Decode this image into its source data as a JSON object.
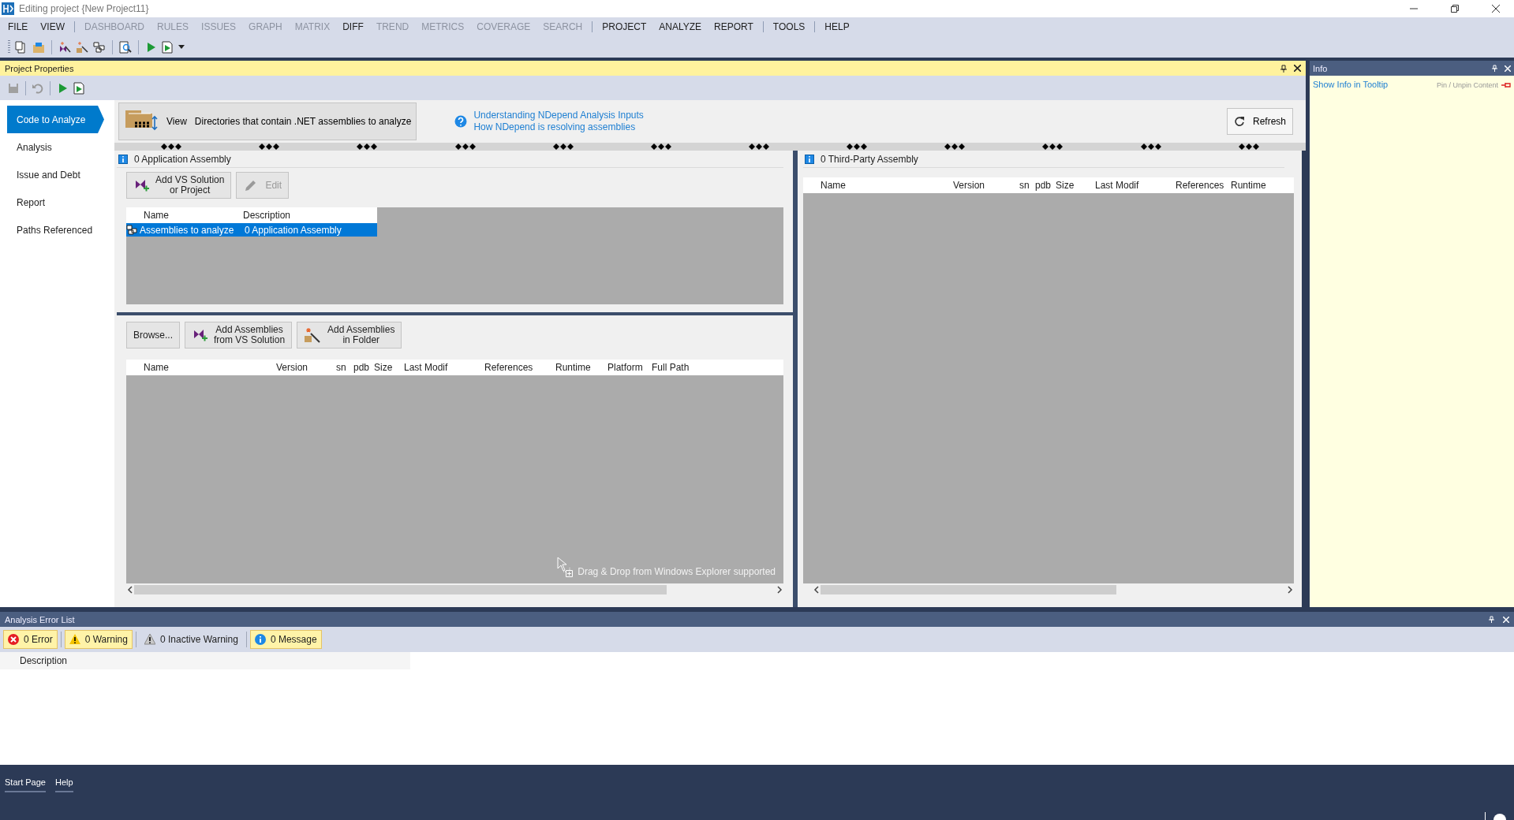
{
  "window": {
    "title": "Editing project {New Project11}"
  },
  "menu_groups": [
    [
      {
        "label": "FILE",
        "disabled": false
      },
      {
        "label": "VIEW",
        "disabled": false
      }
    ],
    [
      {
        "label": "DASHBOARD",
        "disabled": true
      },
      {
        "label": "RULES",
        "disabled": true
      },
      {
        "label": "ISSUES",
        "disabled": true
      },
      {
        "label": "GRAPH",
        "disabled": true
      },
      {
        "label": "MATRIX",
        "disabled": true
      },
      {
        "label": "DIFF",
        "disabled": false
      },
      {
        "label": "TREND",
        "disabled": true
      },
      {
        "label": "METRICS",
        "disabled": true
      },
      {
        "label": "COVERAGE",
        "disabled": true
      },
      {
        "label": "SEARCH",
        "disabled": true
      }
    ],
    [
      {
        "label": "PROJECT",
        "disabled": false
      },
      {
        "label": "ANALYZE",
        "disabled": false
      },
      {
        "label": "REPORT",
        "disabled": false
      }
    ],
    [
      {
        "label": "TOOLS",
        "disabled": false
      }
    ],
    [
      {
        "label": "HELP",
        "disabled": false
      }
    ]
  ],
  "project_properties": {
    "title": "Project Properties",
    "nav": [
      {
        "label": "Code to Analyze",
        "selected": true
      },
      {
        "label": "Analysis",
        "selected": false
      },
      {
        "label": "Issue and Debt",
        "selected": false
      },
      {
        "label": "Report",
        "selected": false
      },
      {
        "label": "Paths Referenced",
        "selected": false
      }
    ],
    "view_button": {
      "label": "View",
      "description": "Directories that contain .NET assemblies to analyze"
    },
    "help_links": [
      "Understanding NDepend Analysis Inputs",
      "How NDepend is resolving assemblies"
    ],
    "refresh_button": "Refresh",
    "application_assemblies": {
      "header": "0 Application Assembly",
      "buttons": [
        {
          "label": "Add VS Solution\nor Project",
          "kind": "vs",
          "disabled": false
        },
        {
          "label": "Edit",
          "kind": "edit",
          "disabled": true
        }
      ],
      "columns": [
        "Name",
        "Description"
      ],
      "rows": [
        {
          "cells": [
            "Assemblies to analyze",
            "0 Application Assembly"
          ],
          "selected": true
        }
      ]
    },
    "assemblies": {
      "buttons": [
        {
          "label": "Browse...",
          "kind": "plain"
        },
        {
          "label": "Add Assemblies\nfrom VS Solution",
          "kind": "vs"
        },
        {
          "label": "Add Assemblies\nin Folder",
          "kind": "folder"
        }
      ],
      "columns": [
        "Name",
        "Version",
        "sn",
        "pdb",
        "Size",
        "Last Modif",
        "References",
        "Runtime",
        "Platform",
        "Full Path"
      ],
      "drop_hint": "Drag & Drop from Windows Explorer supported"
    },
    "third_party": {
      "header": "0 Third-Party Assembly",
      "columns": [
        "Name",
        "Version",
        "sn",
        "pdb",
        "Size",
        "Last Modif",
        "References",
        "Runtime"
      ]
    }
  },
  "info_panel": {
    "title": "Info",
    "link": "Show Info in Tooltip",
    "pin_label": "Pin / Unpin Content"
  },
  "error_list": {
    "title": "Analysis Error List",
    "filters": [
      {
        "label": "0 Error",
        "kind": "error",
        "selected": true
      },
      {
        "label": "0 Warning",
        "kind": "warning",
        "selected": true
      },
      {
        "label": "0 Inactive Warning",
        "kind": "inactive",
        "selected": false
      },
      {
        "label": "0 Message",
        "kind": "message",
        "selected": true
      }
    ],
    "columns": [
      "Description"
    ]
  },
  "bottom_tabs": [
    {
      "label": "Start Page"
    },
    {
      "label": "Help"
    }
  ]
}
